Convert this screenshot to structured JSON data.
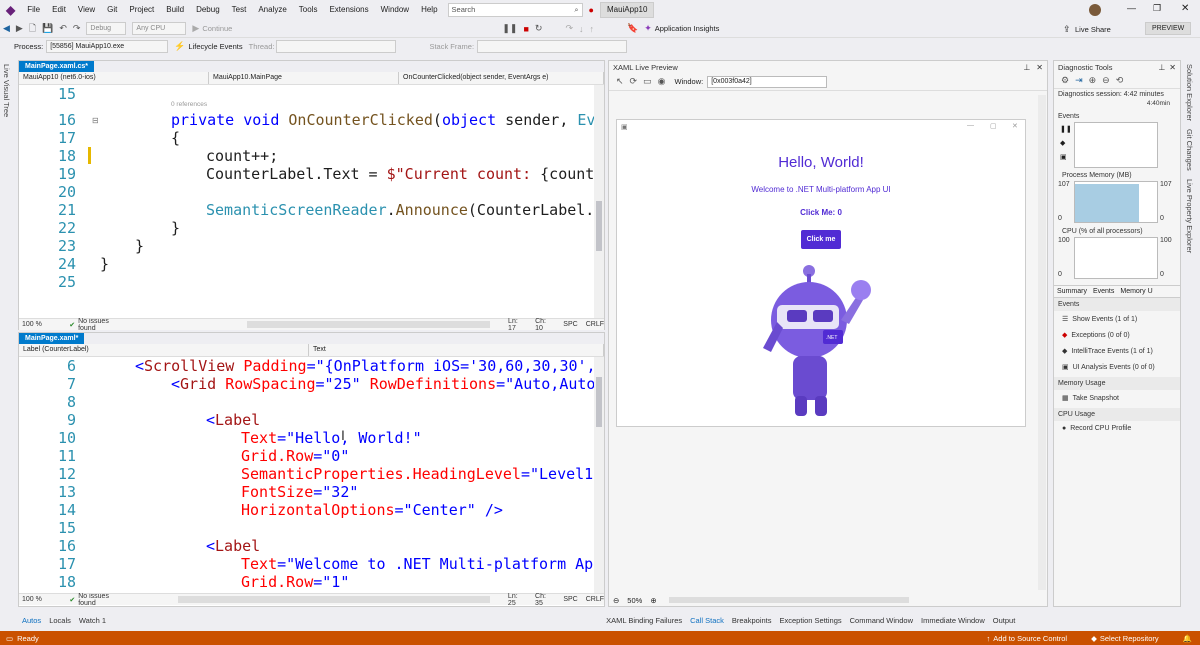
{
  "menu": [
    "File",
    "Edit",
    "View",
    "Git",
    "Project",
    "Build",
    "Debug",
    "Test",
    "Analyze",
    "Tools",
    "Extensions",
    "Window",
    "Help"
  ],
  "search": {
    "placeholder": "Search"
  },
  "app_title": "MauiApp10",
  "user_actions": {
    "live_share": "Live Share",
    "preview": "PREVIEW"
  },
  "toolbar": {
    "config": "Debug",
    "platform": "Any CPU",
    "continue": "Continue",
    "app_insights": "Application Insights"
  },
  "toolbar2": {
    "process_label": "Process:",
    "process_value": "[55856] MauiApp10.exe",
    "lifecycle": "Lifecycle Events",
    "thread": "Thread:",
    "stack_frame": "Stack Frame:"
  },
  "left_sidebar": {
    "label": "Live Visual Tree"
  },
  "right_sidebar": [
    "Solution Explorer",
    "Git Changes",
    "Live Property Explorer"
  ],
  "editor1": {
    "tab": "MainPage.xaml.cs*",
    "nav": [
      "MauiApp10 (net6.0-ios)",
      "MauiApp10.MainPage",
      "OnCounterClicked(object sender, EventArgs e)"
    ],
    "lines": [
      "15",
      "16",
      "17",
      "18",
      "19",
      "20",
      "21",
      "22",
      "23",
      "24",
      "25"
    ],
    "references": "0 references",
    "status": {
      "zoom": "100 %",
      "issues": "No issues found",
      "ln": "Ln: 17",
      "ch": "Ch: 10",
      "spc": "SPC",
      "crlf": "CRLF"
    }
  },
  "editor2": {
    "tab": "MainPage.xaml*",
    "nav": [
      "Label (CounterLabel)",
      "Text"
    ],
    "lines": [
      "6",
      "7",
      "8",
      "9",
      "10",
      "11",
      "12",
      "13",
      "14",
      "15",
      "16",
      "17",
      "18"
    ],
    "status": {
      "zoom": "100 %",
      "issues": "No issues found",
      "ln": "Ln: 25",
      "ch": "Ch: 35",
      "spc": "SPC",
      "crlf": "CRLF"
    }
  },
  "preview": {
    "title": "XAML Live Preview",
    "window_label": "Window:",
    "window_value": "[0x003f0a42]",
    "app": {
      "hello": "Hello, World!",
      "welcome": "Welcome to .NET Multi-platform App UI",
      "count": "Click Me: 0",
      "button": "Click me"
    },
    "bot_badge": ".NET",
    "zoom": "50%"
  },
  "diagnostics": {
    "title": "Diagnostic Tools",
    "session": "Diagnostics session: 4:42 minutes",
    "time_marker": "4:40min",
    "events": "Events",
    "memory": "Process Memory (MB)",
    "mem_max": "107",
    "mem_min": "0",
    "cpu": "CPU (% of all processors)",
    "cpu_max": "100",
    "cpu_min": "0",
    "tabs": [
      "Summary",
      "Events",
      "Memory U"
    ],
    "events_header": "Events",
    "event_items": [
      "Show Events (1 of 1)",
      "Exceptions (0 of 0)",
      "IntelliTrace Events (1 of 1)",
      "UI Analysis Events (0 of 0)"
    ],
    "memory_usage": "Memory Usage",
    "take_snapshot": "Take Snapshot",
    "cpu_usage": "CPU Usage",
    "record_cpu": "Record CPU Profile"
  },
  "bottom_tabs_left": [
    "Autos",
    "Locals",
    "Watch 1"
  ],
  "bottom_tabs_right": [
    "XAML Binding Failures",
    "Call Stack",
    "Breakpoints",
    "Exception Settings",
    "Command Window",
    "Immediate Window",
    "Output"
  ],
  "statusbar": {
    "ready": "Ready",
    "add_source": "Add to Source Control",
    "select_repo": "Select Repository"
  },
  "colors": {
    "accent": "#007acc",
    "status": "#ca5100",
    "maui_purple": "#512bd4"
  }
}
